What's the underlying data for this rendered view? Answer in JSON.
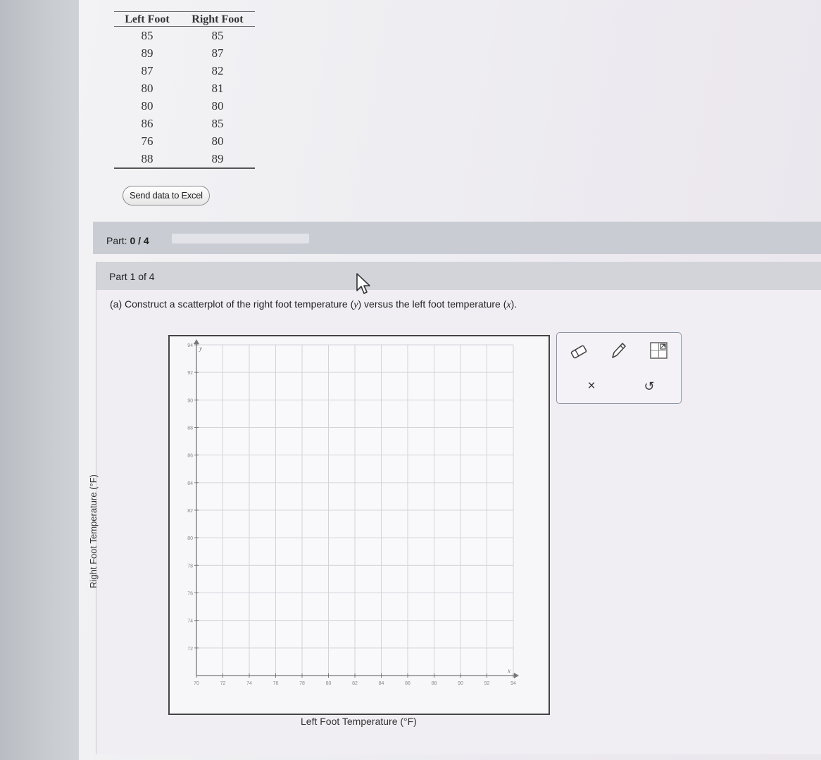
{
  "data_table": {
    "headers": [
      "Left Foot",
      "Right Foot"
    ],
    "rows": [
      [
        "85",
        "85"
      ],
      [
        "89",
        "87"
      ],
      [
        "87",
        "82"
      ],
      [
        "80",
        "81"
      ],
      [
        "80",
        "80"
      ],
      [
        "86",
        "85"
      ],
      [
        "76",
        "80"
      ],
      [
        "88",
        "89"
      ]
    ]
  },
  "send_excel_label": "Send data to Excel",
  "part_progress": {
    "prefix": "Part: ",
    "value": "0 / 4",
    "fraction": 0
  },
  "part_header": "Part 1 of 4",
  "question": {
    "prefix": "(a) Construct a scatterplot of the right foot temperature (",
    "y_var": "y",
    "middle": ") versus the left foot temperature (",
    "x_var": "x",
    "suffix": ")."
  },
  "chart_data": {
    "type": "scatter",
    "xlabel": "Left Foot Temperature (°F)",
    "ylabel": "Right Foot Temperature (°F)",
    "x_corner_label": "x",
    "y_corner_label": "y",
    "xlim": [
      70,
      94
    ],
    "ylim": [
      70,
      94
    ],
    "x_ticks": [
      70,
      72,
      74,
      76,
      78,
      80,
      82,
      84,
      86,
      88,
      90,
      92,
      94
    ],
    "y_ticks": [
      70,
      72,
      74,
      76,
      78,
      80,
      82,
      84,
      86,
      88,
      90,
      92,
      94
    ],
    "grid": true,
    "points": []
  },
  "tools": {
    "eraser": "eraser-icon",
    "pencil": "pencil-icon",
    "expand": "expand-icon",
    "clear": "×",
    "undo": "↺"
  }
}
